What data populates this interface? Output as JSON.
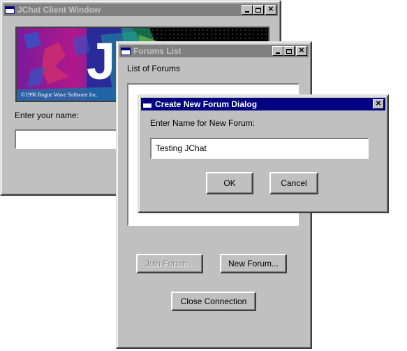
{
  "client_window": {
    "title": "JChat Client Window",
    "logo_letter": "J",
    "logo_copyright": "©1996 Rogue Wave Software Inc.",
    "name_prompt": "Enter your name:",
    "name_value": ""
  },
  "forums_window": {
    "title": "Forums List",
    "list_label": "List of Forums",
    "join_button": "Join Forum...",
    "new_button": "New Forum...",
    "close_button": "Close Connection"
  },
  "dialog": {
    "title": "Create New Forum Dialog",
    "prompt": "Enter Name for New Forum:",
    "input_value": "Testing JChat",
    "ok_button": "OK",
    "cancel_button": "Cancel"
  },
  "colors": {
    "active_title": "#000080",
    "inactive_title": "#808080",
    "face": "#c0c0c0"
  }
}
